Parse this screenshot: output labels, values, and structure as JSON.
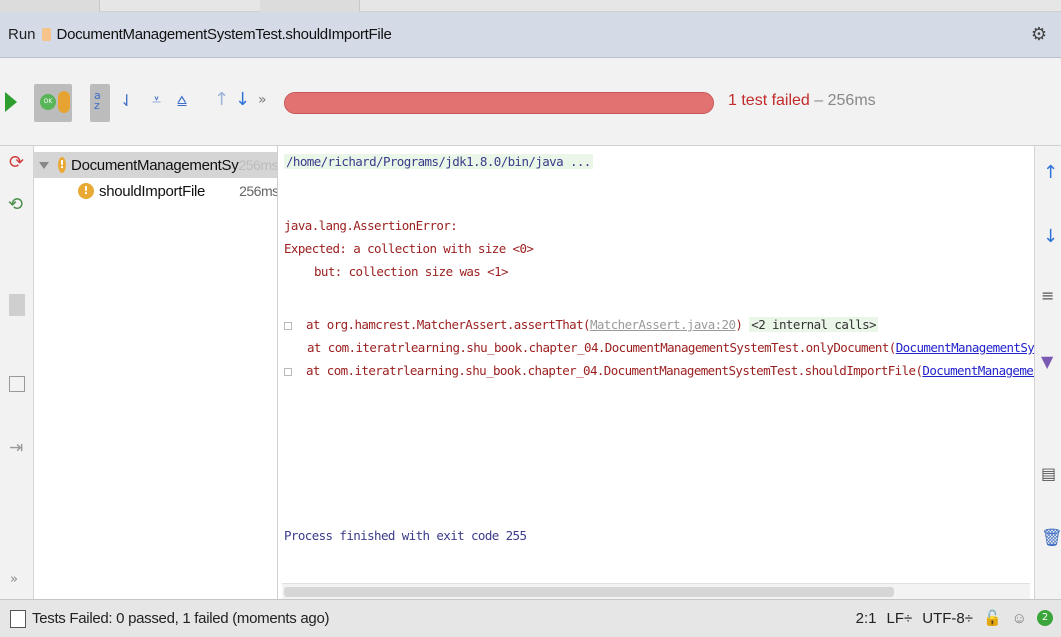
{
  "titlebar": {
    "run_label": "Run",
    "config_name": "DocumentManagementSystemTest.shouldImportFile"
  },
  "toolbar": {
    "rerun_icon": "play-icon",
    "show_passed_label": "OK",
    "status_failed": "1 test failed",
    "status_sep": " – ",
    "status_time": "256ms",
    "progress_fraction": 1.0,
    "progress_color": "#e27272",
    "more_label": "»"
  },
  "tree": {
    "root": {
      "name": "DocumentManagementSy",
      "time": "256ms"
    },
    "child": {
      "name": "shouldImportFile",
      "time": "256ms"
    }
  },
  "console": {
    "cmd": "/home/richard/Programs/jdk1.8.0/bin/java ...",
    "error_type": "java.lang.AssertionError:",
    "expected": "Expected: a collection with size <0>",
    "but": "but: collection size was <1>",
    "st1_prefix": "at org.hamcrest.MatcherAssert.assertThat(",
    "st1_link": "MatcherAssert.java:20",
    "st1_suffix": ")",
    "st1_internal": "<2 internal calls>",
    "st2_prefix": "at com.iteratrlearning.shu_book.chapter_04.DocumentManagementSystemTest.onlyDocument(",
    "st2_link": "DocumentManagementSystemTest.jav",
    "st3_prefix": "at com.iteratrlearning.shu_book.chapter_04.DocumentManagementSystemTest.shouldImportFile(",
    "st3_link": "DocumentManagementSystemTest",
    "process": "Process finished with exit code 255"
  },
  "statusbar": {
    "message": "Tests Failed: 0 passed, 1 failed (moments ago)",
    "position": "2:1",
    "line_sep": "LF÷",
    "encoding": "UTF-8÷"
  },
  "colors": {
    "fail": "#c12b2b",
    "pass": "#2e9e2e",
    "warning": "#e9a935"
  }
}
